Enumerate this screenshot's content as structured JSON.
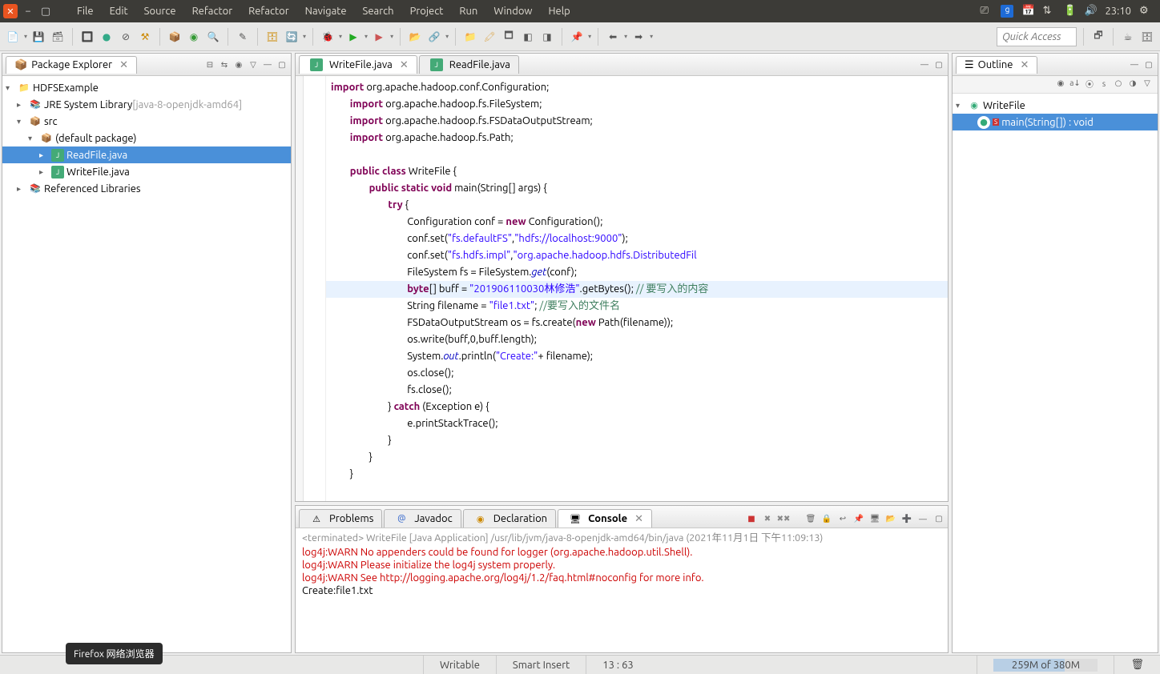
{
  "topbar": {
    "menus": [
      "File",
      "Edit",
      "Source",
      "Refactor",
      "Refactor",
      "Navigate",
      "Search",
      "Project",
      "Run",
      "Window",
      "Help"
    ],
    "clock": "23:10"
  },
  "quickaccess": {
    "placeholder": "Quick Access"
  },
  "explorer": {
    "title": "Package Explorer",
    "close_glyph": "✕",
    "project": "HDFSExample",
    "jre": "JRE System Library",
    "jre_version": "[java-8-openjdk-amd64]",
    "src": "src",
    "pkg": "(default package)",
    "files": [
      "ReadFile.java",
      "WriteFile.java"
    ],
    "refs": "Referenced Libraries"
  },
  "editor": {
    "tabs": [
      {
        "label": "WriteFile.java",
        "active": true
      },
      {
        "label": "ReadFile.java",
        "active": false
      }
    ],
    "close_glyph": "✕"
  },
  "code": {
    "l1a": "import",
    "l1b": " org.apache.hadoop.conf.Configuration;",
    "l2a": "import",
    "l2b": " org.apache.hadoop.fs.FileSystem;",
    "l3a": "import",
    "l3b": " org.apache.hadoop.fs.FSDataOutputStream;",
    "l4a": "import",
    "l4b": " org.apache.hadoop.fs.Path;",
    "l6a": "public class",
    "l6b": " WriteFile {",
    "l7a": "public static void",
    "l7b": " main(String[] args) {",
    "l8a": "try",
    "l8b": " {",
    "l9a": "Configuration conf = ",
    "l9n": "new",
    "l9b": " Configuration();",
    "l10a": "conf.set(",
    "l10s1": "\"fs.defaultFS\"",
    "l10c": ",",
    "l10s2": "\"hdfs://localhost:9000\"",
    "l10b": ");",
    "l11a": "conf.set(",
    "l11s1": "\"fs.hdfs.impl\"",
    "l11c": ",",
    "l11s2": "\"org.apache.hadoop.hdfs.DistributedFil",
    "l11b": "",
    "l12a": "FileSystem fs = FileSystem.",
    "l12g": "get",
    "l12b": "(conf);",
    "l13a": "byte",
    "l13b": "[] buff = ",
    "l13s": "\"201906110030林修浩\"",
    "l13c": ".getBytes(); ",
    "l13cm": "// 要写入的内容",
    "l14a": "String filename = ",
    "l14s": "\"file1.txt\"",
    "l14b": "; ",
    "l14cm": "//要写入的文件名",
    "l15a": "FSDataOutputStream os = fs.create(",
    "l15n": "new",
    "l15b": " Path(filename));",
    "l16": "os.write(buff,0,buff.length);",
    "l17a": "System.",
    "l17o": "out",
    "l17b": ".println(",
    "l17s": "\"Create:\"",
    "l17c": "+ filename);",
    "l18": "os.close();",
    "l19": "fs.close();",
    "l20a": "} ",
    "l20c": "catch",
    "l20b": " (Exception e) {",
    "l21": "e.printStackTrace();",
    "l22": "}",
    "l23": "}",
    "l24": "}"
  },
  "bottom": {
    "tabs": [
      "Problems",
      "Javadoc",
      "Declaration",
      "Console"
    ],
    "active": 3,
    "console_title": "<terminated> WriteFile [Java Application] /usr/lib/jvm/java-8-openjdk-amd64/bin/java (2021年11月1日 下午11:09:13)",
    "lines": [
      {
        "t": "log4j:WARN No appenders could be found for logger (org.apache.hadoop.util.Shell).",
        "warn": true
      },
      {
        "t": "log4j:WARN Please initialize the log4j system properly.",
        "warn": true
      },
      {
        "t": "log4j:WARN See http://logging.apache.org/log4j/1.2/faq.html#noconfig for more info.",
        "warn": true
      },
      {
        "t": "Create:file1.txt",
        "warn": false
      }
    ]
  },
  "outline": {
    "title": "Outline",
    "close_glyph": "✕",
    "class": "WriteFile",
    "method": "main(String[]) : void"
  },
  "status": {
    "writable": "Writable",
    "insert": "Smart Insert",
    "pos": "13 : 63",
    "heap": "259M of 380M",
    "heap_pct": 68
  },
  "tooltip": "Firefox 网络浏览器"
}
